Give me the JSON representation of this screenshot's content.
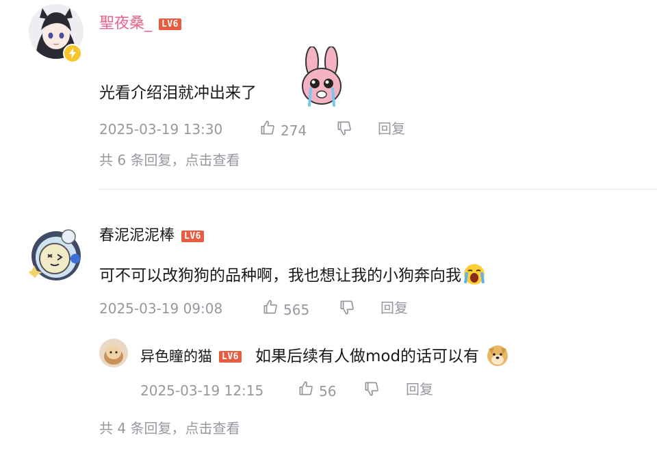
{
  "comments": [
    {
      "user": "聖夜桑_",
      "level": "LV6",
      "text": "光看介绍泪就冲出来了",
      "emoji": "crying-bunny-sticker",
      "time": "2025-03-19 13:30",
      "likes": "274",
      "reply_label": "回复",
      "replies_summary": "共 6 条回复，点击查看",
      "name_color": "#e8638a"
    },
    {
      "user": "春泥泥泥棒",
      "level": "LV6",
      "text": "可不可以改狗狗的品种啊，我也想让我的小狗奔向我",
      "emoji": "loud-crying-emoji",
      "time": "2025-03-19 09:08",
      "likes": "565",
      "reply_label": "回复",
      "sub_reply": {
        "user": "异色瞳的猫",
        "level": "LV6",
        "text": "如果后续有人做mod的话可以有",
        "emoji": "doge-emoji",
        "time": "2025-03-19 12:15",
        "likes": "56",
        "reply_label": "回复"
      },
      "replies_summary": "共 4 条回复，点击查看"
    }
  ],
  "icons": {
    "like": "thumbs-up-icon",
    "dislike": "thumbs-down-icon",
    "badge": "lightning-badge-icon"
  },
  "colors": {
    "level_badge": "#e85d3f",
    "meta_text": "#9499a0",
    "divider": "#e3e5e7",
    "badge_yellow": "#f7c52a"
  }
}
